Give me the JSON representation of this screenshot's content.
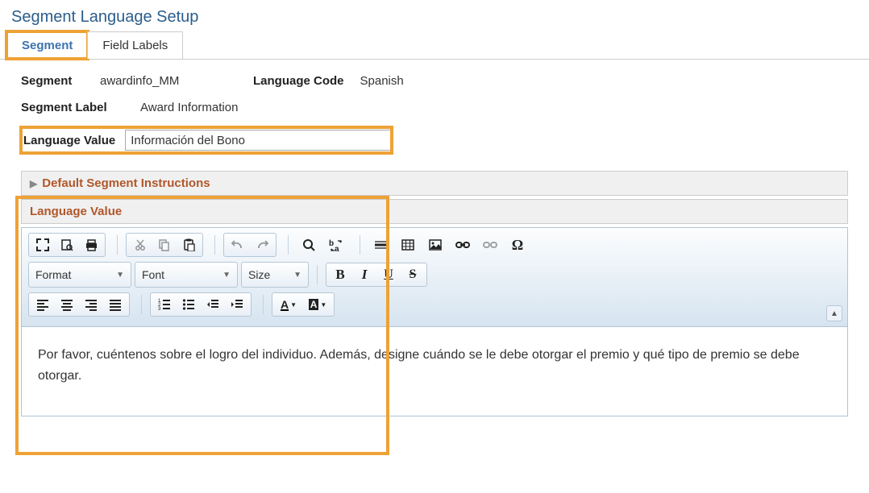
{
  "page_title": "Segment Language Setup",
  "tabs": [
    {
      "label": "Segment",
      "active": true
    },
    {
      "label": "Field Labels",
      "active": false
    }
  ],
  "fields": {
    "segment_label": "Segment",
    "segment_value": "awardinfo_MM",
    "language_code_label": "Language Code",
    "language_code_value": "Spanish",
    "segment_label_label": "Segment Label",
    "segment_label_value": "Award Information",
    "language_value_label": "Language Value",
    "language_value_input": "Información del Bono"
  },
  "sections": {
    "default_instructions_header": "Default Segment Instructions",
    "language_value_header": "Language Value"
  },
  "editor": {
    "format_label": "Format",
    "font_label": "Font",
    "size_label": "Size",
    "content": "Por favor, cuéntenos sobre el logro del individuo. Además, designe cuándo se le debe otorgar el premio y qué tipo de premio se debe otorgar."
  }
}
